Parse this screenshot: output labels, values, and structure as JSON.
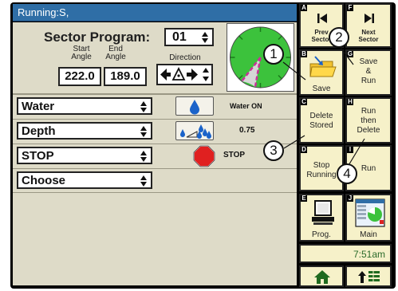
{
  "status": {
    "title": "Running:S,"
  },
  "sector": {
    "title": "Sector Program:",
    "program_value": "01",
    "start_label": "Start\nAngle",
    "end_label": "End\nAngle",
    "direction_label": "Direction",
    "start_angle": "222.0",
    "end_angle": "189.0"
  },
  "gauge": {
    "on_color": "#3cc23c",
    "off_color": "#d8d8d8",
    "arm_color": "#c9309a"
  },
  "rows": [
    {
      "select": "Water",
      "status": "Water ON",
      "icon": "water-drop-icon"
    },
    {
      "select": "Depth",
      "status": "0.75",
      "icon": "depth-drops-icon"
    },
    {
      "select": "STOP",
      "status": "STOP",
      "icon": "stop-sign-icon"
    },
    {
      "select": "Choose",
      "status": "",
      "icon": ""
    }
  ],
  "side_buttons": [
    {
      "letter": "A",
      "label": "Prev\nSector",
      "icon": "skip-back-icon"
    },
    {
      "letter": "F",
      "label": "Next\nSector",
      "icon": "skip-forward-icon"
    },
    {
      "letter": "B",
      "label": "Save",
      "icon": "save-folder-icon"
    },
    {
      "letter": "G",
      "label": "Save\n&\nRun"
    },
    {
      "letter": "C",
      "label": "Delete\nStored"
    },
    {
      "letter": "H",
      "label": "Run\nthen\nDelete"
    },
    {
      "letter": "D",
      "label": "Stop\nRunning"
    },
    {
      "letter": "I",
      "label": "Run"
    },
    {
      "letter": "E",
      "label": "Prog.",
      "icon": "computer-icon"
    },
    {
      "letter": "J",
      "label": "Main",
      "icon": "main-screen-icon"
    }
  ],
  "clock": {
    "time": "7:51am"
  },
  "bottom": {
    "home_icon": "home-icon",
    "menu_icon": "up-menu-icon"
  },
  "callouts": [
    "1",
    "2",
    "3",
    "4"
  ],
  "colors": {
    "header": "#2f6ea6",
    "panel": "#dedbc8",
    "button": "#f6f1c9",
    "accent_green": "#3cc23c"
  }
}
